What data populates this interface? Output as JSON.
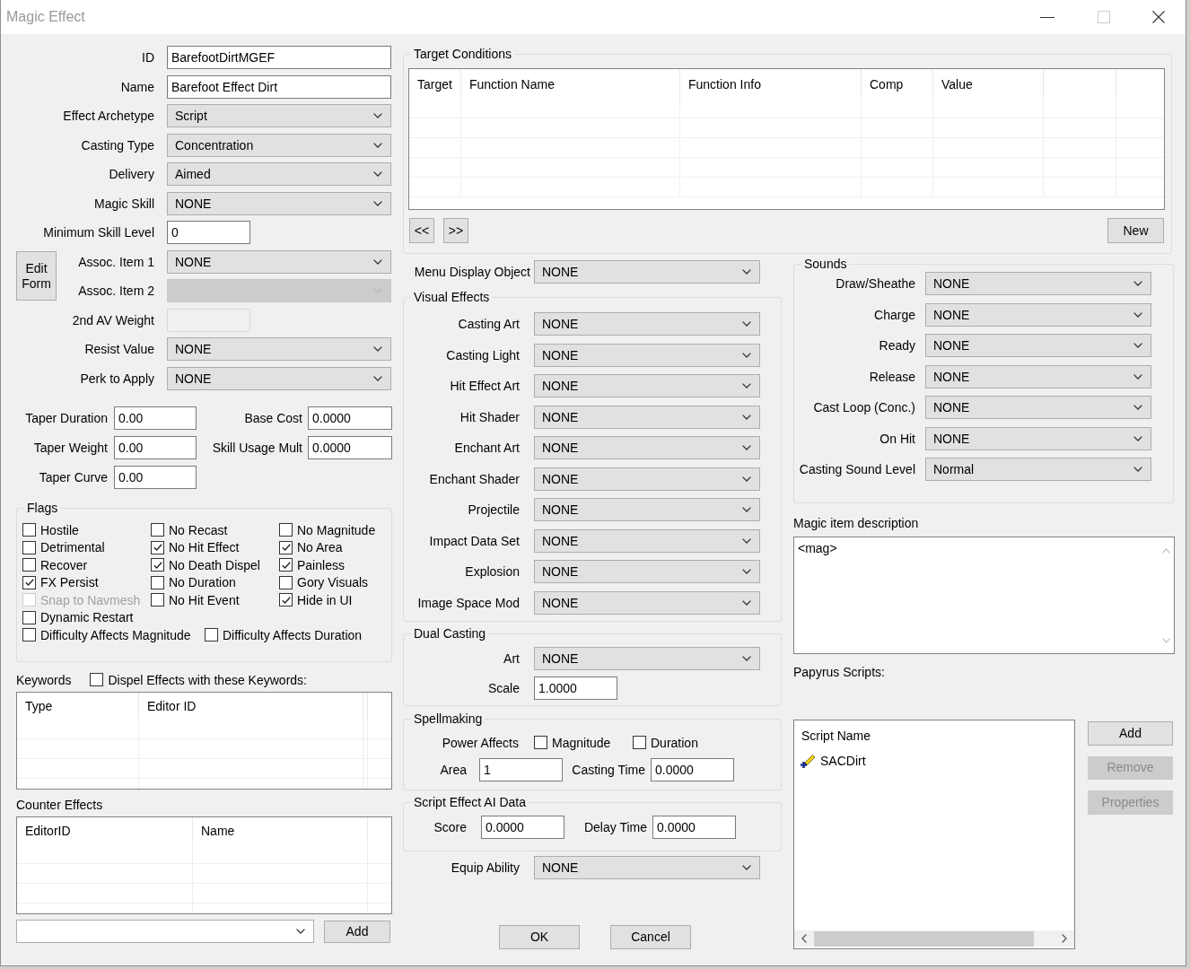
{
  "window": {
    "title": "Magic Effect",
    "maximize_disabled": true
  },
  "record": {
    "fields": [
      {
        "label": "ID",
        "kind": "text",
        "value": "BarefootDirtMGEF",
        "disabled": false
      },
      {
        "label": "Name",
        "kind": "text",
        "value": "Barefoot Effect Dirt",
        "disabled": false
      },
      {
        "label": "Effect Archetype",
        "kind": "dropdown",
        "value": "Script",
        "disabled": false
      },
      {
        "label": "Casting Type",
        "kind": "dropdown",
        "value": "Concentration",
        "disabled": false
      },
      {
        "label": "Delivery",
        "kind": "dropdown",
        "value": "Aimed",
        "disabled": false
      },
      {
        "label": "Magic Skill",
        "kind": "dropdown",
        "value": "NONE",
        "disabled": false
      },
      {
        "label": "Minimum Skill Level",
        "kind": "number",
        "value": "0",
        "disabled": false
      }
    ],
    "edit_form_button": "Edit Form",
    "assoc_fields": [
      {
        "label": "Assoc. Item 1",
        "kind": "dropdown",
        "value": "NONE",
        "disabled": false
      },
      {
        "label": "Assoc. Item 2",
        "kind": "dropdown",
        "disabled": true
      }
    ],
    "more_fields": [
      {
        "label": "2nd AV Weight",
        "kind": "number",
        "disabled": true
      },
      {
        "label": "Resist Value",
        "kind": "dropdown",
        "value": "NONE",
        "disabled": false
      },
      {
        "label": "Perk to Apply",
        "kind": "dropdown",
        "value": "NONE",
        "disabled": false
      }
    ]
  },
  "taper_fields": [
    {
      "label": "Taper Duration",
      "value": "0.00"
    },
    {
      "label": "Taper Weight",
      "value": "0.00"
    },
    {
      "label": "Taper Curve",
      "value": "0.00"
    }
  ],
  "cost_fields": [
    {
      "label": "Base Cost",
      "value": "0.0000"
    },
    {
      "label": "Skill Usage Mult",
      "value": "0.0000"
    }
  ],
  "flags": {
    "title": "Flags",
    "rows": [
      [
        {
          "label": "Hostile",
          "checked": false,
          "disabled": false
        },
        {
          "label": "No Recast",
          "checked": false,
          "disabled": false
        },
        {
          "label": "No Magnitude",
          "checked": false,
          "disabled": false
        }
      ],
      [
        {
          "label": "Detrimental",
          "checked": false,
          "disabled": false
        },
        {
          "label": "No Hit Effect",
          "checked": true,
          "disabled": false
        },
        {
          "label": "No Area",
          "checked": true,
          "disabled": false
        }
      ],
      [
        {
          "label": "Recover",
          "checked": false,
          "disabled": false
        },
        {
          "label": "No Death Dispel",
          "checked": true,
          "disabled": false
        },
        {
          "label": "Painless",
          "checked": true,
          "disabled": false
        }
      ],
      [
        {
          "label": "FX Persist",
          "checked": true,
          "disabled": false
        },
        {
          "label": "No Duration",
          "checked": false,
          "disabled": false
        },
        {
          "label": "Gory Visuals",
          "checked": false,
          "disabled": false
        }
      ],
      [
        {
          "label": "Snap to Navmesh",
          "checked": false,
          "disabled": true
        },
        {
          "label": "No Hit Event",
          "checked": false,
          "disabled": false
        },
        {
          "label": "Hide in UI",
          "checked": true,
          "disabled": false
        }
      ],
      [
        {
          "label": "Dynamic Restart",
          "checked": false,
          "disabled": false
        }
      ],
      [
        {
          "label": "Difficulty Affects Magnitude",
          "checked": false,
          "disabled": false
        },
        {
          "label": "Difficulty Affects Duration",
          "checked": false,
          "disabled": false
        }
      ]
    ]
  },
  "keywords": {
    "title": "Keywords",
    "dispel": {
      "label": "Dispel Effects with these Keywords:",
      "checked": false
    },
    "columns": [
      "Type",
      "Editor ID"
    ]
  },
  "counter_effects": {
    "title": "Counter Effects",
    "columns": [
      "EditorID",
      "Name"
    ],
    "add_button": "Add"
  },
  "target_conditions": {
    "title": "Target Conditions",
    "columns": [
      "Target",
      "Function Name",
      "Function Info",
      "Comp",
      "Value"
    ],
    "nav_buttons": [
      "<<",
      ">>"
    ],
    "new_button": "New"
  },
  "menu_display_object": {
    "label": "Menu Display Object",
    "value": "NONE"
  },
  "visual_effects": {
    "title": "Visual Effects",
    "fields": [
      {
        "label": "Casting Art",
        "value": "NONE"
      },
      {
        "label": "Casting Light",
        "value": "NONE"
      },
      {
        "label": "Hit Effect Art",
        "value": "NONE"
      },
      {
        "label": "Hit Shader",
        "value": "NONE"
      },
      {
        "label": "Enchant Art",
        "value": "NONE"
      },
      {
        "label": "Enchant Shader",
        "value": "NONE"
      },
      {
        "label": "Projectile",
        "value": "NONE"
      },
      {
        "label": "Impact Data Set",
        "value": "NONE"
      },
      {
        "label": "Explosion",
        "value": "NONE"
      },
      {
        "label": "Image Space Mod",
        "value": "NONE"
      }
    ]
  },
  "dual_casting": {
    "title": "Dual Casting",
    "fields": [
      {
        "label": "Art",
        "kind": "dropdown",
        "value": "NONE"
      },
      {
        "label": "Scale",
        "kind": "number",
        "value": "1.0000"
      }
    ]
  },
  "spellmaking": {
    "title": "Spellmaking",
    "power_affects": {
      "label": "Power Affects",
      "options": [
        {
          "label": "Magnitude",
          "checked": false
        },
        {
          "label": "Duration",
          "checked": false
        }
      ]
    },
    "fields": [
      {
        "label": "Area",
        "value": "1"
      },
      {
        "label": "Casting Time",
        "value": "0.0000"
      }
    ]
  },
  "script_effect_ai": {
    "title": "Script Effect AI Data",
    "fields": [
      {
        "label": "Score",
        "value": "0.0000"
      },
      {
        "label": "Delay Time",
        "value": "0.0000"
      }
    ]
  },
  "equip_ability": {
    "label": "Equip Ability",
    "value": "NONE"
  },
  "dialog_buttons": [
    "OK",
    "Cancel"
  ],
  "sounds": {
    "title": "Sounds",
    "fields": [
      {
        "label": "Draw/Sheathe",
        "value": "NONE"
      },
      {
        "label": "Charge",
        "value": "NONE"
      },
      {
        "label": "Ready",
        "value": "NONE"
      },
      {
        "label": "Release",
        "value": "NONE"
      },
      {
        "label": "Cast Loop (Conc.)",
        "value": "NONE"
      },
      {
        "label": "On Hit",
        "value": "NONE"
      },
      {
        "label": "Casting Sound Level",
        "value": "Normal"
      }
    ]
  },
  "description": {
    "label": "Magic item description",
    "value": "<mag>"
  },
  "papyrus": {
    "label": "Papyrus Scripts:",
    "column": "Script Name",
    "scripts": [
      "SACDirt"
    ],
    "buttons": [
      {
        "label": "Add",
        "disabled": false
      },
      {
        "label": "Remove",
        "disabled": true
      },
      {
        "label": "Properties",
        "disabled": true
      }
    ]
  }
}
